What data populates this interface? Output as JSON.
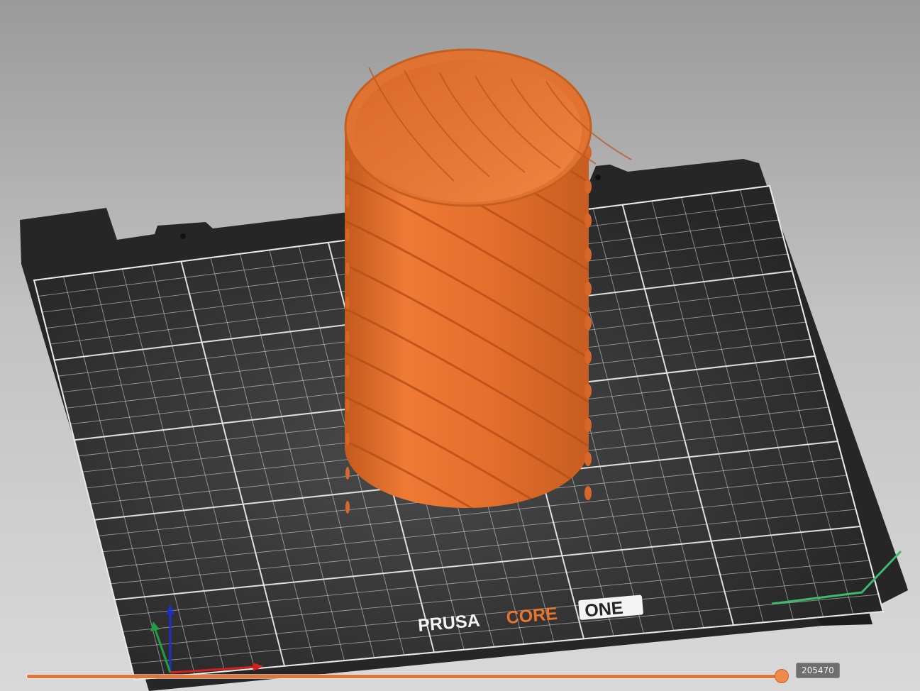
{
  "app": {
    "view": "3D preview",
    "printer_logo": {
      "word1": "PRUSA",
      "word2": "CORE",
      "word3": "ONE"
    }
  },
  "object": {
    "shape": "cylinder-vase-with-spiral-ribs",
    "color": "#e8742f"
  },
  "bed": {
    "sheet_color": "#2f2f2f",
    "frame_color": "#262626",
    "grid_color": "#e9e9e9"
  },
  "axes": {
    "x_color": "#d02020",
    "y_color": "#20a040",
    "z_color": "#1e2fd0"
  },
  "slider": {
    "value_label": "205470",
    "position_fraction": 1.0,
    "accent_color": "#e0743a"
  }
}
